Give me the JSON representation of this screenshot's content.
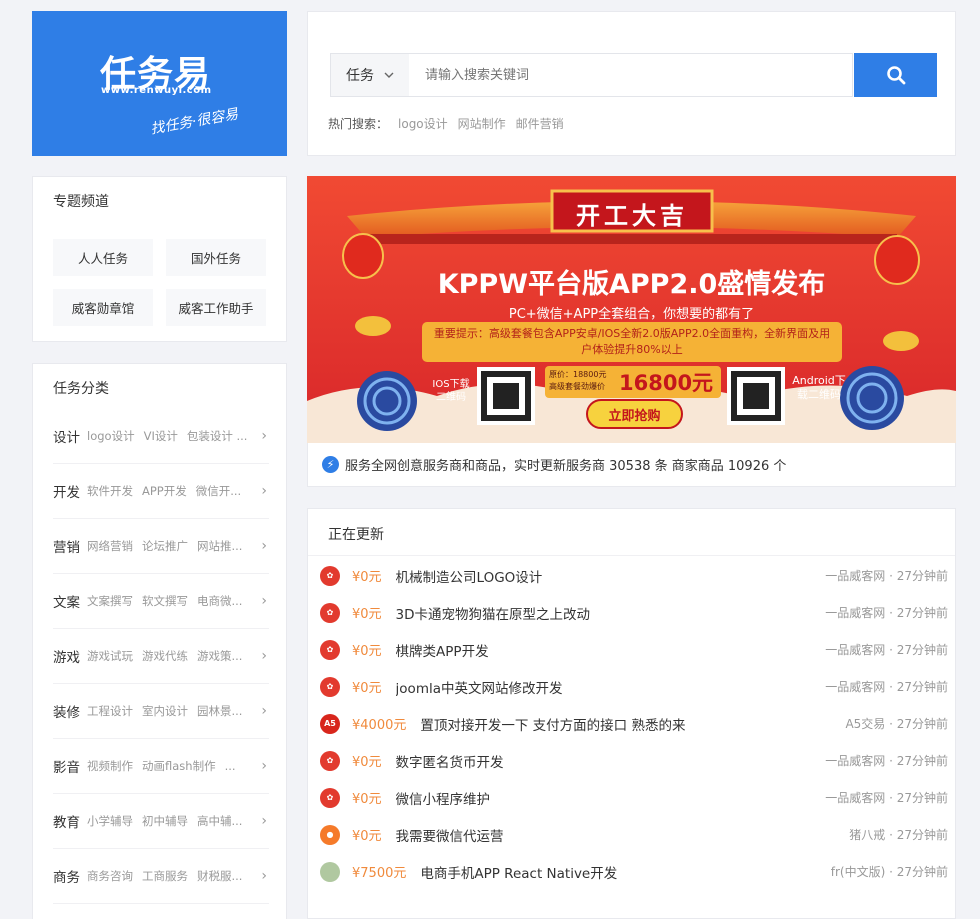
{
  "logo": {
    "main": "任务易",
    "url": "www.renwuyi.com",
    "slogan": "找任务·很容易"
  },
  "search": {
    "category": "任务",
    "placeholder": "请输入搜索关键词",
    "hot_label": "热门搜索：",
    "hot_tags": [
      "logo设计",
      "网站制作",
      "邮件营销"
    ]
  },
  "topics": {
    "title": "专题频道",
    "items": [
      "人人任务",
      "国外任务",
      "威客勋章馆",
      "威客工作助手"
    ]
  },
  "categories": {
    "title": "任务分类",
    "rows": [
      {
        "name": "设计",
        "subs": [
          "logo设计",
          "VI设计",
          "包装设计 ..."
        ]
      },
      {
        "name": "开发",
        "subs": [
          "软件开发",
          "APP开发",
          "微信开..."
        ]
      },
      {
        "name": "营销",
        "subs": [
          "网络营销",
          "论坛推广",
          "网站推..."
        ]
      },
      {
        "name": "文案",
        "subs": [
          "文案撰写",
          "软文撰写",
          "电商微..."
        ]
      },
      {
        "name": "游戏",
        "subs": [
          "游戏试玩",
          "游戏代练",
          "游戏策..."
        ]
      },
      {
        "name": "装修",
        "subs": [
          "工程设计",
          "室内设计",
          "园林景..."
        ]
      },
      {
        "name": "影音",
        "subs": [
          "视频制作",
          "动画flash制作",
          "..."
        ]
      },
      {
        "name": "教育",
        "subs": [
          "小学辅导",
          "初中辅导",
          "高中辅..."
        ]
      },
      {
        "name": "商务",
        "subs": [
          "商务咨询",
          "工商服务",
          "财税服..."
        ]
      }
    ]
  },
  "banner": {
    "stamp": "开工大吉",
    "headline": "KPPW平台版APP2.0盛情发布",
    "sub": "PC+微信+APP全套组合，你想要的都有了",
    "notice": "重要提示：高级套餐包含APP安卓/IOS全新2.0版APP2.0全面重构，全新界面及用户体验提升80%以上",
    "ios_label": "IOS下载二维码",
    "android_label": "Android下载二维码",
    "orig_price": "原价：18800元",
    "deal_label": "高级套餐劲爆价",
    "price": "16800元",
    "buy_button": "立即抢购"
  },
  "banner_info": "服务全网创意服务商和商品，实时更新服务商 30538 条 商家商品 10926 个",
  "updates": {
    "title": "正在更新",
    "rows": [
      {
        "price": "¥0元",
        "title": "机械制造公司LOGO设计",
        "meta": "一品威客网 · 27分钟前",
        "avatar": "weike"
      },
      {
        "price": "¥0元",
        "title": "3D卡通宠物狗猫在原型之上改动",
        "meta": "一品威客网 · 27分钟前",
        "avatar": "weike"
      },
      {
        "price": "¥0元",
        "title": "棋牌类APP开发",
        "meta": "一品威客网 · 27分钟前",
        "avatar": "weike"
      },
      {
        "price": "¥0元",
        "title": "joomla中英文网站修改开发",
        "meta": "一品威客网 · 27分钟前",
        "avatar": "weike"
      },
      {
        "price": "¥4000元",
        "title": "置顶对接开发一下 支付方面的接口 熟悉的来",
        "meta": "A5交易 · 27分钟前",
        "avatar": "a5"
      },
      {
        "price": "¥0元",
        "title": "数字匿名货币开发",
        "meta": "一品威客网 · 27分钟前",
        "avatar": "weike"
      },
      {
        "price": "¥0元",
        "title": "微信小程序维护",
        "meta": "一品威客网 · 27分钟前",
        "avatar": "weike"
      },
      {
        "price": "¥0元",
        "title": "我需要微信代运营",
        "meta": "猪八戒 · 27分钟前",
        "avatar": "zbj"
      },
      {
        "price": "¥7500元",
        "title": "电商手机APP React Native开发",
        "meta": "fr(中文版) · 27分钟前",
        "avatar": "none"
      }
    ]
  },
  "colors": {
    "accent": "#2f7ee6",
    "price": "#f08a3c",
    "banner_red": "#e33b2d"
  }
}
